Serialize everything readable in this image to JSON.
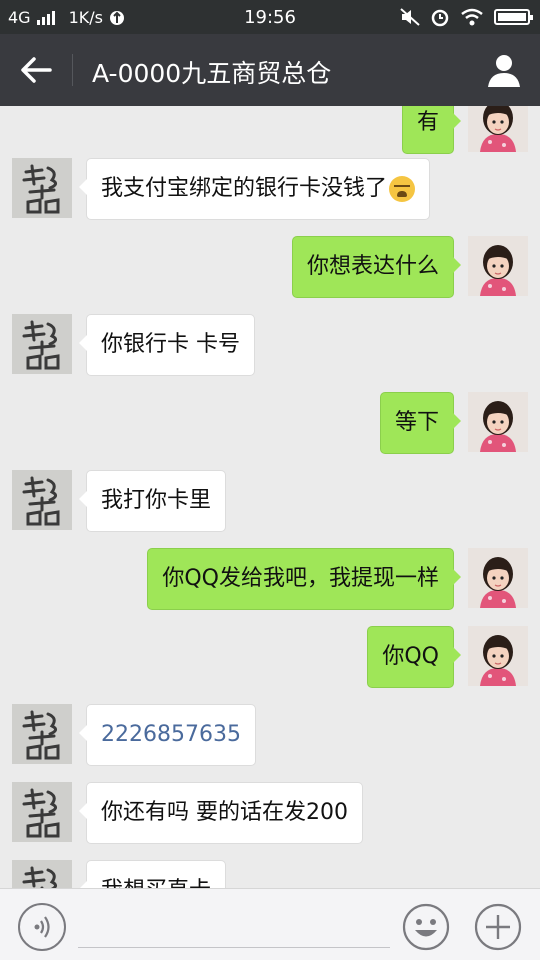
{
  "status_bar": {
    "network": "4G",
    "speed": "1K/s",
    "time": "19:56"
  },
  "header": {
    "title": "A-0000九五商贸总仓"
  },
  "messages": [
    {
      "side": "out",
      "text": "有"
    },
    {
      "side": "in",
      "text": "我支付宝绑定的银行卡没钱了",
      "emoji": "crying-face-icon"
    },
    {
      "side": "out",
      "text": "你想表达什么"
    },
    {
      "side": "in",
      "text": "你银行卡  卡号"
    },
    {
      "side": "out",
      "text": "等下"
    },
    {
      "side": "in",
      "text": "我打你卡里"
    },
    {
      "side": "out",
      "text": "你QQ发给我吧，我提现一样"
    },
    {
      "side": "out",
      "text": "你QQ"
    },
    {
      "side": "in",
      "text": "2226857635"
    },
    {
      "side": "in",
      "text": "你还有吗   要的话在发200"
    },
    {
      "side": "in",
      "text": "我想买直卡"
    }
  ],
  "colors": {
    "outgoing_bubble": "#9fe658",
    "incoming_bubble": "#ffffff",
    "header_bg": "#393a3f",
    "chat_bg": "#ebebeb"
  }
}
